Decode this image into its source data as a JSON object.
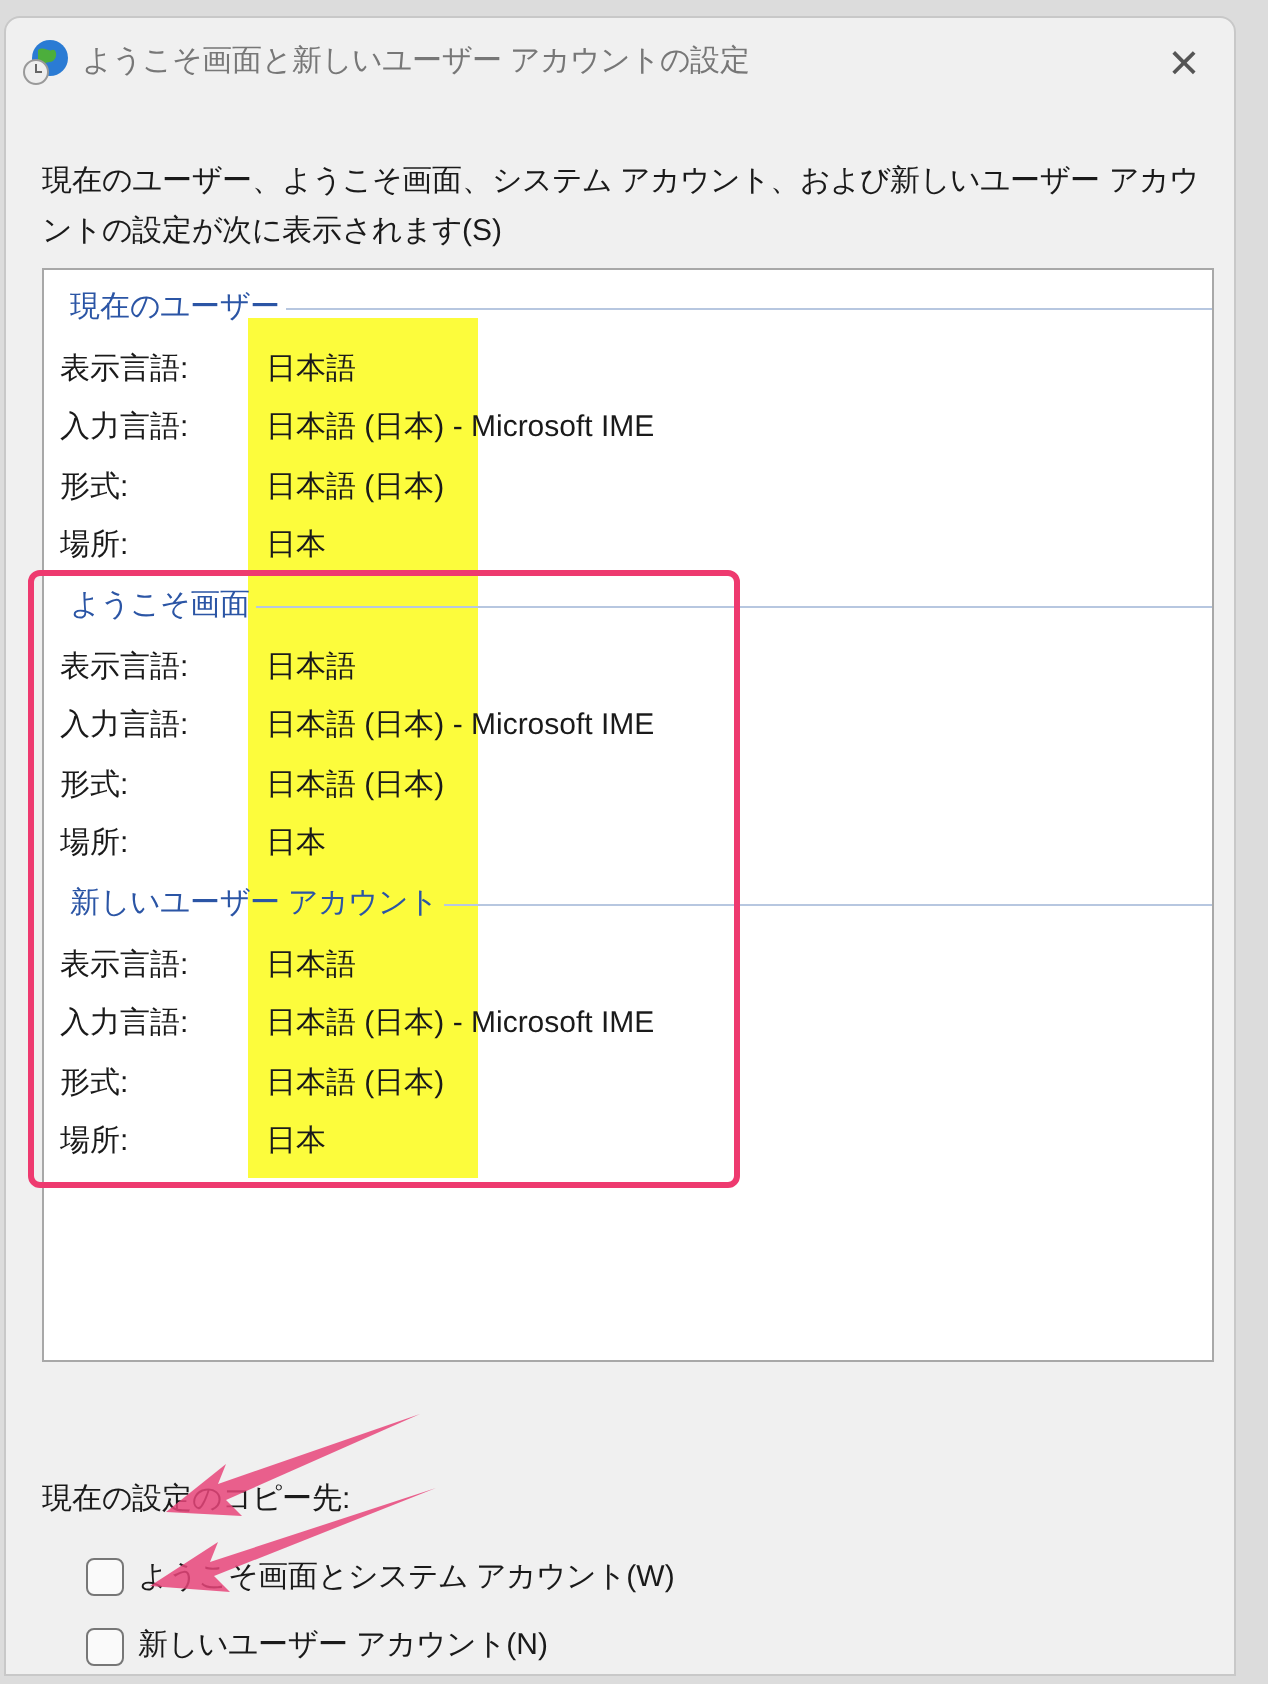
{
  "window": {
    "title": "ようこそ画面と新しいユーザー アカウントの設定",
    "close": "×"
  },
  "description": "現在のユーザー、ようこそ画面、システム アカウント、および新しいユーザー アカウントの設定が次に表示されます(S)",
  "sections": [
    {
      "title": "現在のユーザー",
      "rows": [
        {
          "label": "表示言語:",
          "value": "日本語"
        },
        {
          "label": "入力言語:",
          "value": "日本語 (日本) - Microsoft IME"
        },
        {
          "label": "形式:",
          "value": "日本語 (日本)"
        },
        {
          "label": "場所:",
          "value": "日本"
        }
      ]
    },
    {
      "title": "ようこそ画面",
      "rows": [
        {
          "label": "表示言語:",
          "value": "日本語"
        },
        {
          "label": "入力言語:",
          "value": "日本語 (日本) - Microsoft IME"
        },
        {
          "label": "形式:",
          "value": "日本語 (日本)"
        },
        {
          "label": "場所:",
          "value": "日本"
        }
      ]
    },
    {
      "title": "新しいユーザー アカウント",
      "rows": [
        {
          "label": "表示言語:",
          "value": "日本語"
        },
        {
          "label": "入力言語:",
          "value": "日本語 (日本) - Microsoft IME"
        },
        {
          "label": "形式:",
          "value": "日本語 (日本)"
        },
        {
          "label": "場所:",
          "value": "日本"
        }
      ]
    }
  ],
  "copy_label": "現在の設定のコピー先:",
  "checkboxes": [
    {
      "label": "ようこそ画面とシステム アカウント(W)",
      "checked": false
    },
    {
      "label": "新しいユーザー アカウント(N)",
      "checked": false
    }
  ]
}
